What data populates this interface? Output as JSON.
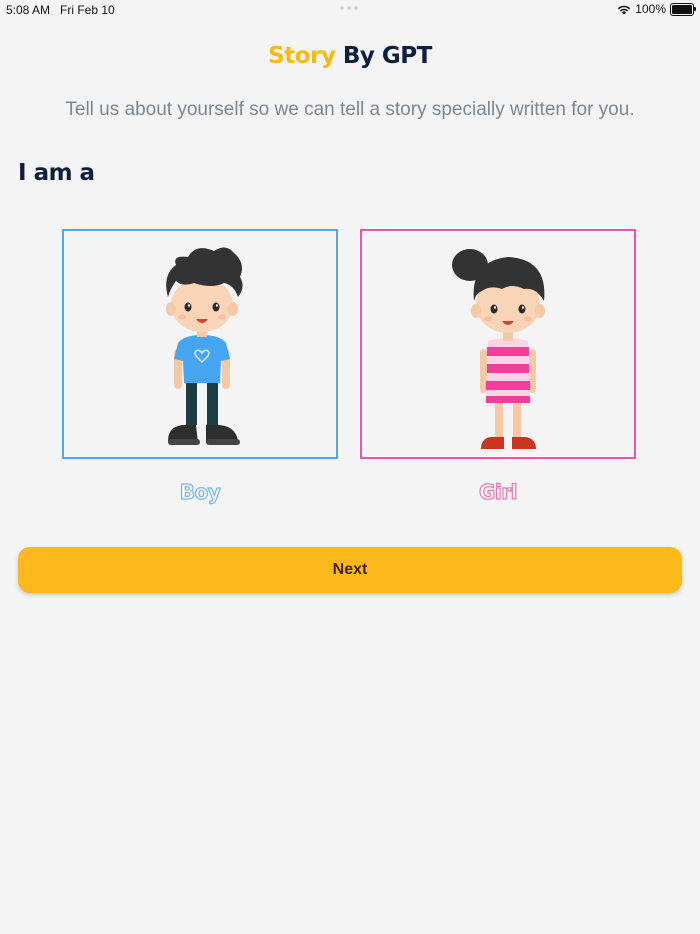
{
  "status_bar": {
    "time": "5:08 AM",
    "date": "Fri Feb 10",
    "battery": "100%"
  },
  "header": {
    "title_part1": "Story",
    "title_part2": " By GPT"
  },
  "subtitle": "Tell us about yourself so we can tell a story specially written for you.",
  "section_heading": "I am a",
  "choices": [
    {
      "label": "Boy",
      "accent": "#58a6e6"
    },
    {
      "label": "Girl",
      "accent": "#e45aa6"
    }
  ],
  "next_button": {
    "label": "Next"
  },
  "colors": {
    "brand_yellow": "#fdb813",
    "navy": "#0c1f3f",
    "background": "#f4f4f4"
  }
}
